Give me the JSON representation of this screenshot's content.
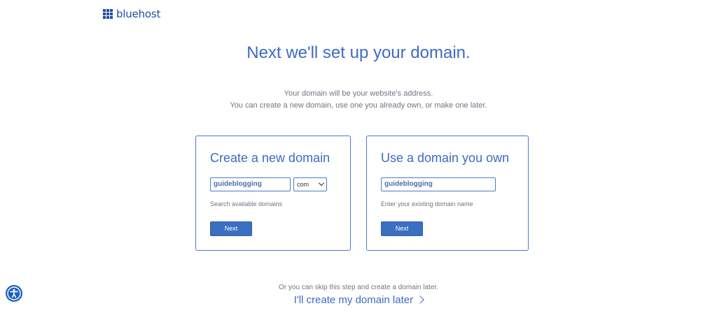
{
  "logo": {
    "text": "bluehost"
  },
  "headline": "Next we'll set up your domain.",
  "subtext": {
    "line1": "Your domain will be your website's address.",
    "line2": "You can create a new domain, use one you already own, or make one later."
  },
  "cards": {
    "new_domain": {
      "title": "Create a new domain",
      "input_value": "guideblogging",
      "tld_selected": "com",
      "helper": "Search available domains",
      "button_label": "Next"
    },
    "own_domain": {
      "title": "Use a domain you own",
      "input_value": "guideblogging",
      "helper": "Enter your existing domain name",
      "button_label": "Next"
    }
  },
  "footer": {
    "skip_text": "Or you can skip this step and create a domain later.",
    "skip_link": "I'll create my domain later"
  },
  "icons": {
    "logo": "grid-icon",
    "accessibility": "accessibility-icon",
    "select": "chevron-down-icon",
    "link": "chevron-right-icon"
  },
  "colors": {
    "brand": "#1f4fa0",
    "accent": "#3d6bc4",
    "button": "#3a6fc1"
  }
}
